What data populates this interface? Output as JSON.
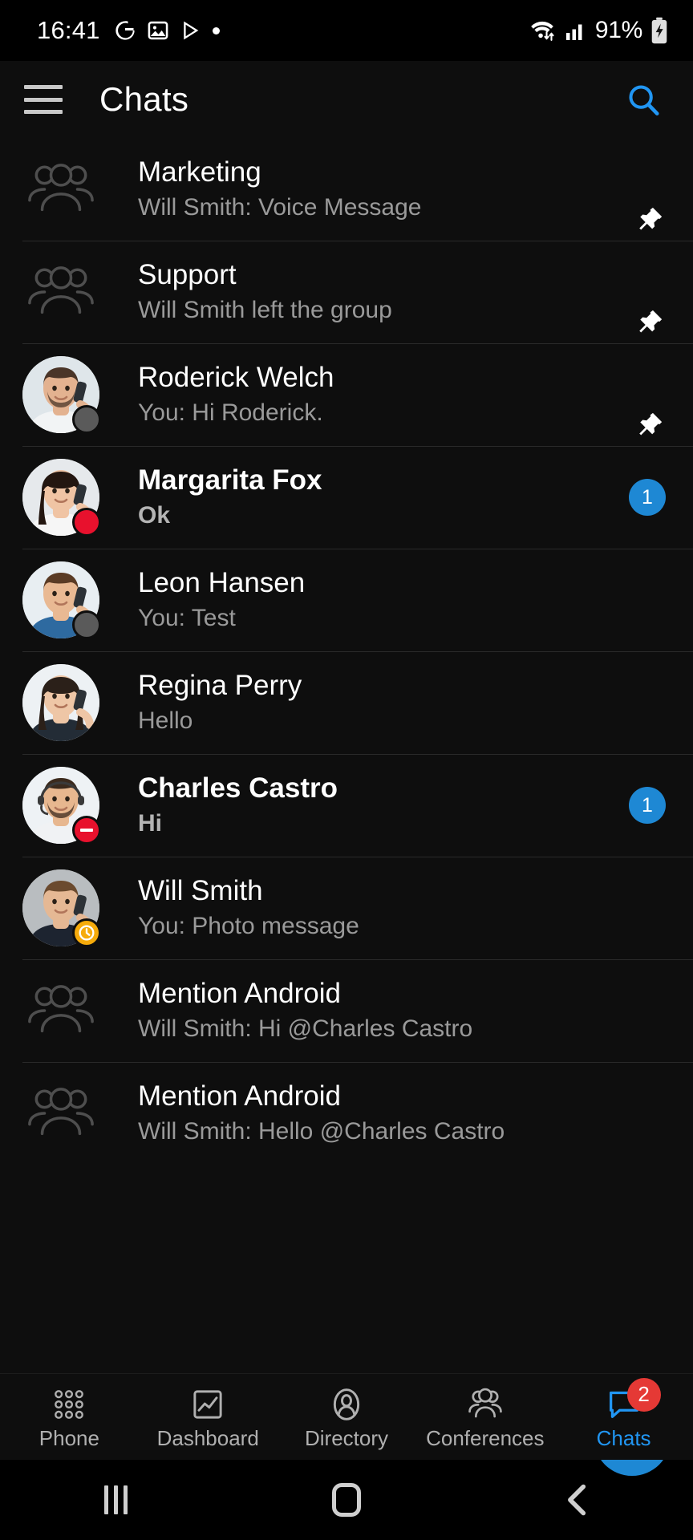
{
  "statusbar": {
    "time": "16:41",
    "left_icons": [
      "google-icon",
      "gallery-icon",
      "play-store-icon",
      "dot-icon"
    ],
    "battery_text": "91%",
    "right_icons": [
      "wifi-icon",
      "cellular-signal-icon",
      "battery-charging-icon"
    ]
  },
  "appbar": {
    "menu_icon": "hamburger-menu-icon",
    "title": "Chats",
    "search_icon": "search-icon"
  },
  "chats": [
    {
      "name": "Marketing",
      "preview": "Will Smith: Voice Message",
      "avatar_type": "group",
      "status": "none",
      "pinned": true,
      "unread": 0,
      "bold": false
    },
    {
      "name": "Support",
      "preview": "Will Smith left the group",
      "avatar_type": "group",
      "status": "none",
      "pinned": true,
      "unread": 0,
      "bold": false
    },
    {
      "name": "Roderick Welch",
      "preview": "You: Hi Roderick.",
      "avatar_type": "photo-man-beard-phone",
      "status": "offline",
      "pinned": true,
      "unread": 0,
      "bold": false
    },
    {
      "name": "Margarita Fox",
      "preview": "Ok",
      "avatar_type": "photo-woman-darkhair-phone",
      "status": "busy",
      "pinned": false,
      "unread": 1,
      "bold": true
    },
    {
      "name": "Leon Hansen",
      "preview": "You: Test",
      "avatar_type": "photo-man-smiling-phone",
      "status": "offline",
      "pinned": false,
      "unread": 0,
      "bold": false
    },
    {
      "name": "Regina Perry",
      "preview": "Hello",
      "avatar_type": "photo-woman-suit-phone",
      "status": "none",
      "pinned": false,
      "unread": 0,
      "bold": false
    },
    {
      "name": "Charles Castro",
      "preview": "Hi",
      "avatar_type": "photo-man-headset",
      "status": "dnd",
      "pinned": false,
      "unread": 1,
      "bold": true
    },
    {
      "name": "Will Smith",
      "preview": "You: Photo message",
      "avatar_type": "photo-man-suit-phone",
      "status": "away",
      "pinned": false,
      "unread": 0,
      "bold": false
    },
    {
      "name": "Mention Android",
      "preview": "Will Smith: Hi @Charles Castro",
      "avatar_type": "group",
      "status": "none",
      "pinned": false,
      "unread": 0,
      "bold": false
    },
    {
      "name": "Mention Android",
      "preview": "Will Smith: Hello @Charles Castro",
      "avatar_type": "group",
      "status": "none",
      "pinned": false,
      "unread": 0,
      "bold": false
    }
  ],
  "fab": {
    "icon": "plus-icon",
    "label": "+"
  },
  "bottomnav": {
    "items": [
      {
        "label": "Phone",
        "icon": "dialpad-icon",
        "active": false,
        "badge": ""
      },
      {
        "label": "Dashboard",
        "icon": "chart-icon",
        "active": false,
        "badge": ""
      },
      {
        "label": "Directory",
        "icon": "person-icon",
        "active": false,
        "badge": ""
      },
      {
        "label": "Conferences",
        "icon": "group-icon",
        "active": false,
        "badge": ""
      },
      {
        "label": "Chats",
        "icon": "chat-bubble-icon",
        "active": true,
        "badge": "2"
      }
    ]
  },
  "sysnav": {
    "recents_icon": "recents-icon",
    "home_icon": "home-icon",
    "back_icon": "back-icon"
  },
  "colors": {
    "accent": "#1e88d4",
    "accent_text": "#2196f3",
    "badge_red": "#e53935",
    "background": "#0e0e0e",
    "status_busy": "#e8112d",
    "status_away": "#f6ab0b",
    "status_offline": "#5a5a5a"
  }
}
